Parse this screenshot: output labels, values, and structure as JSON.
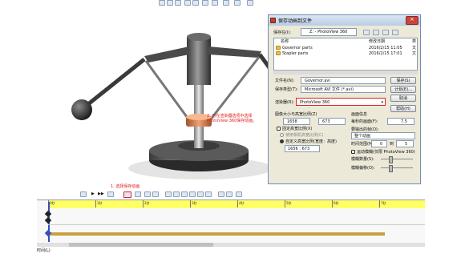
{
  "top_toolbar": {
    "icons": [
      "search-icon",
      "zoom-icon",
      "rotate-icon",
      "view-icon",
      "section-icon",
      "display-icon",
      "hide-icon",
      "appearance-icon",
      "scene-icon",
      "monitor-icon"
    ]
  },
  "dialog": {
    "title": "保存动画到文件",
    "save_in_label": "保存在(I):",
    "save_in_value": "Z: - PhotoView 360",
    "list_headers": {
      "name": "名称",
      "date": "修改日期",
      "type": "类"
    },
    "files": [
      {
        "name": "Governor parts",
        "date": "2016/2/15 11:05",
        "type": "文"
      },
      {
        "name": "Stapler parts",
        "date": "2016/2/15 17:01",
        "type": "文"
      }
    ],
    "filename_label": "文件名(N):",
    "filename_value": "Governor.avi",
    "filetype_label": "保存类型(T):",
    "filetype_value": "Microsoft AVI 文件 (*.avi)",
    "save_button": "保存(S)",
    "schedule_button": "计划(E)...",
    "cancel_button": "取消",
    "help_button": "帮助(H)",
    "renderer_label": "渲染器(R):",
    "renderer_value": "PhotoView 360",
    "image_size_label": "图像大小与高宽比例(Z)",
    "width_value": "1658",
    "height_value": "673",
    "fixed_ratio_label": "固定高宽比例(X)",
    "use_camera_ratio_label": "使用相机高宽比例(C)",
    "custom_ratio_label": "自定义高宽比例(宽度：高度)",
    "custom_ratio_value": "1656 : 673",
    "frame_info_title": "画面信息",
    "fps_label": "每秒的画面(F):",
    "fps_value": "7.5",
    "frames_to_output_label": "要输出的帧(O):",
    "frames_to_output_value": "整个动画",
    "time_range_label": "时间范围(M):",
    "time_from": "0",
    "time_to_label": "到",
    "time_to": "5",
    "motion_blur_label": "运动模糊(仅限 PhotoView 360)",
    "blur_amount_label": "模糊数量(S):",
    "blur_offset_label": "模糊偏移(O):"
  },
  "annotations": {
    "renderer_note": "2. 可在渲染器选项中选择PhotoView 360保存动画。",
    "save_anim_note": "1. 选择保存动画"
  },
  "timeline": {
    "ticks": [
      "0秒",
      "1秒",
      "2秒",
      "3秒",
      "4秒",
      "5秒",
      "6秒",
      "7秒"
    ],
    "status_text": "时间(L)",
    "bar_color": "#c8a03c",
    "timeline_highlight": "#ffff66"
  }
}
